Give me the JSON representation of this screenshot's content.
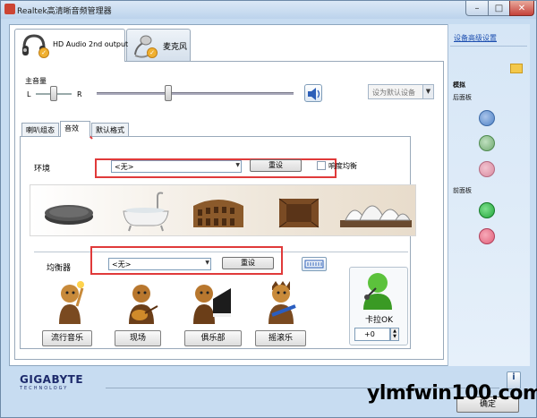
{
  "window": {
    "title": "Realtek高清晰音频管理器"
  },
  "device_tabs": [
    {
      "label": "HD Audio 2nd output"
    },
    {
      "label": "麦克风"
    }
  ],
  "volume": {
    "title": "主音量",
    "left": "L",
    "right": "R",
    "level_percent": 36,
    "balance": "center"
  },
  "default_device": {
    "label": "设为默认设备"
  },
  "sub_tabs": [
    {
      "label": "喇叭组态"
    },
    {
      "label": "音效"
    },
    {
      "label": "默认格式"
    }
  ],
  "environment": {
    "label": "环境",
    "selected": "<无>",
    "reset_label": "重设",
    "loudness_label": "响度均衡",
    "presets": [
      "stone",
      "bathtub",
      "colosseum",
      "room",
      "opera-house"
    ]
  },
  "equalizer": {
    "label": "均衡器",
    "selected": "<无>",
    "reset_label": "重设",
    "presets": [
      {
        "label": "流行音乐"
      },
      {
        "label": "现场"
      },
      {
        "label": "俱乐部"
      },
      {
        "label": "摇滚乐"
      }
    ]
  },
  "karaoke": {
    "label": "卡拉OK",
    "value": "+0"
  },
  "right_panel": {
    "advanced_link": "设备高级设置",
    "analog_label": "模拟",
    "back_panel_label": "后面板",
    "front_panel_label": "前面板",
    "jacks": {
      "back": [
        "#4e82c6",
        "#6fa86f",
        "#d88aa0"
      ],
      "front": [
        "#22a63a",
        "#e0607a"
      ]
    }
  },
  "footer": {
    "brand": "GIGABYTE",
    "tagline": "TECHNOLOGY",
    "info": "i",
    "ok_label": "确定"
  },
  "watermark": "ylmfwin100.com"
}
